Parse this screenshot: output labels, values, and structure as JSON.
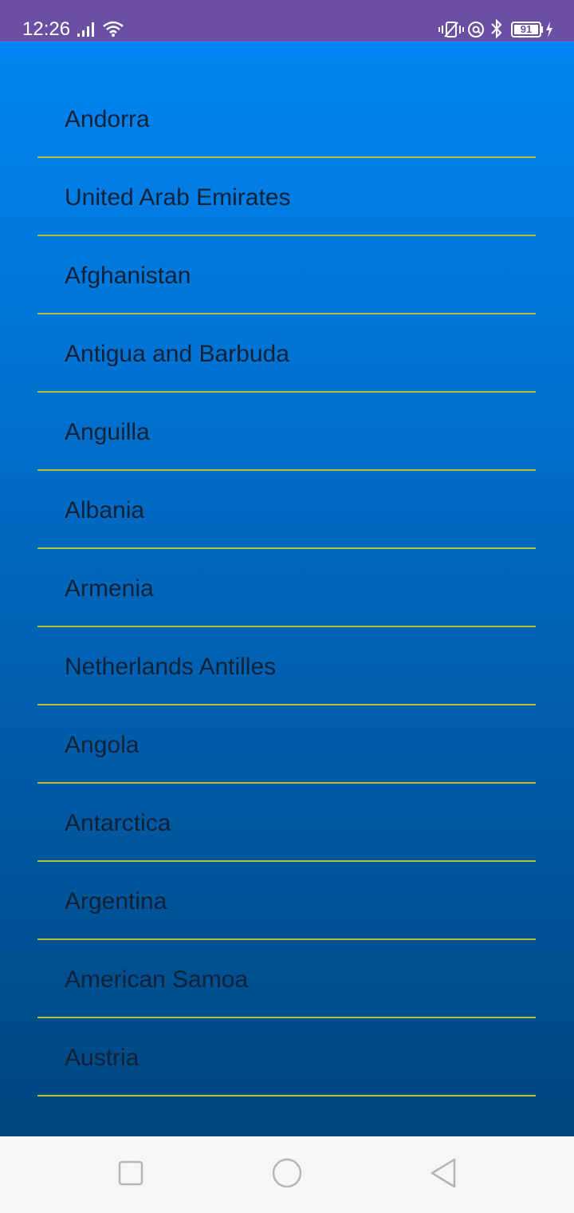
{
  "status_bar": {
    "time": "12:26",
    "battery_level": "91",
    "background_color": "#6a4fa3",
    "icons": [
      "signal-icon",
      "wifi-icon",
      "vibrate-icon",
      "at-sign-icon",
      "bluetooth-icon",
      "battery-icon",
      "charging-icon"
    ]
  },
  "list": {
    "divider_color": "#b3c237",
    "text_color": "#102238",
    "background_top": "#0086f3",
    "background_bottom": "#00467e",
    "items": [
      {
        "label": "Andorra"
      },
      {
        "label": "United Arab Emirates"
      },
      {
        "label": "Afghanistan"
      },
      {
        "label": "Antigua and Barbuda"
      },
      {
        "label": "Anguilla"
      },
      {
        "label": "Albania"
      },
      {
        "label": "Armenia"
      },
      {
        "label": "Netherlands Antilles"
      },
      {
        "label": "Angola"
      },
      {
        "label": "Antarctica"
      },
      {
        "label": "Argentina"
      },
      {
        "label": "American Samoa"
      },
      {
        "label": "Austria"
      }
    ]
  },
  "nav_bar": {
    "buttons": [
      "recents-square-icon",
      "home-circle-icon",
      "back-triangle-icon"
    ]
  }
}
